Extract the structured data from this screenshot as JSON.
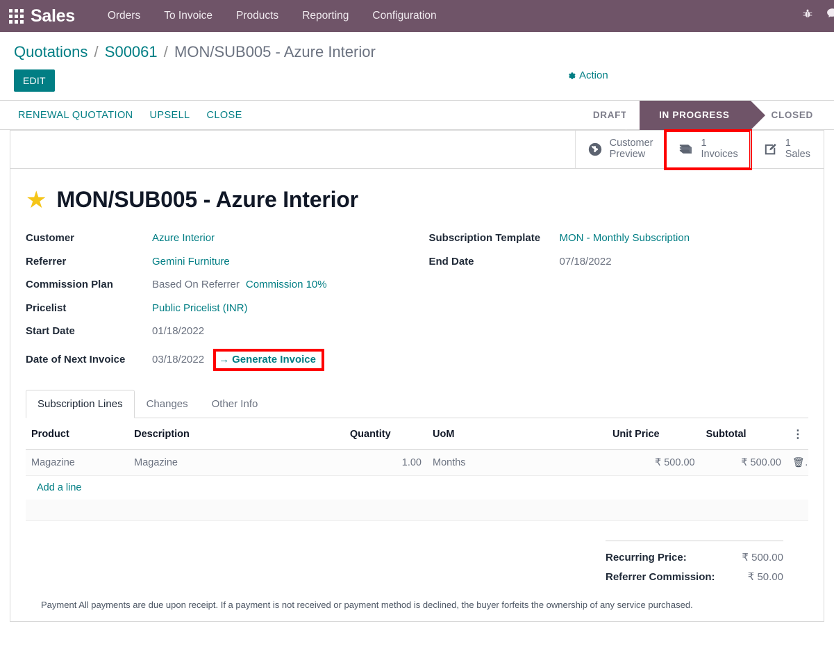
{
  "navbar": {
    "apps_icon": "apps-grid-icon",
    "brand": "Sales",
    "menus": [
      {
        "label": "Orders"
      },
      {
        "label": "To Invoice"
      },
      {
        "label": "Products"
      },
      {
        "label": "Reporting"
      },
      {
        "label": "Configuration"
      }
    ],
    "sys_icons": [
      {
        "name": "bug-icon",
        "glyph": "☲"
      },
      {
        "name": "messages-icon",
        "glyph": "●"
      }
    ],
    "background": "#6f5468"
  },
  "breadcrumb": {
    "root": "Quotations",
    "sep": "/",
    "parent": "S00061",
    "current": "MON/SUB005 - Azure Interior"
  },
  "control_panel": {
    "edit_label": "EDIT",
    "action_label": "Action",
    "action_icon": "gear-icon"
  },
  "statusbar": {
    "buttons": [
      {
        "label": "RENEWAL QUOTATION"
      },
      {
        "label": "UPSELL"
      },
      {
        "label": "CLOSE"
      }
    ],
    "stages": [
      {
        "label": "DRAFT",
        "active": false
      },
      {
        "label": "IN PROGRESS",
        "active": true
      },
      {
        "label": "CLOSED",
        "active": false
      }
    ],
    "active_color": "#6f5468"
  },
  "stat_buttons": [
    {
      "icon": "globe-icon",
      "value": "Customer",
      "label": "Preview",
      "highlighted": false
    },
    {
      "icon": "book-icon",
      "value": "1",
      "label": "Invoices",
      "highlighted": true
    },
    {
      "icon": "edit-square-icon",
      "value": "1",
      "label": "Sales",
      "highlighted": false
    }
  ],
  "record": {
    "star_icon": "star-filled-icon",
    "title": "MON/SUB005 - Azure Interior"
  },
  "form": {
    "left": [
      {
        "label": "Customer",
        "value": "Azure Interior",
        "link": true
      },
      {
        "label": "Referrer",
        "value": "Gemini Furniture",
        "link": true
      },
      {
        "label": "Commission Plan",
        "value": "Based On Referrer",
        "extra": "Commission 10%",
        "link": false
      },
      {
        "label": "Pricelist",
        "value": "Public Pricelist (INR)",
        "link": true
      },
      {
        "label": "Start Date",
        "value": "01/18/2022",
        "link": false
      },
      {
        "label": "Date of Next Invoice",
        "value": "03/18/2022",
        "link": false,
        "action": "Generate Invoice",
        "action_icon": "arrow-right-icon",
        "highlighted": true
      }
    ],
    "right": [
      {
        "label": "Subscription Template",
        "value": "MON - Monthly Subscription",
        "link": true
      },
      {
        "label": "End Date",
        "value": "07/18/2022",
        "link": false
      }
    ]
  },
  "notebook": {
    "tabs": [
      {
        "label": "Subscription Lines",
        "active": true
      },
      {
        "label": "Changes",
        "active": false
      },
      {
        "label": "Other Info",
        "active": false
      }
    ]
  },
  "lines_table": {
    "columns": [
      "Product",
      "Description",
      "Quantity",
      "UoM",
      "Unit Price",
      "Subtotal"
    ],
    "optional_columns_icon": "vertical-dots-icon",
    "rows": [
      {
        "product": "Magazine",
        "description": "Magazine",
        "quantity": "1.00",
        "uom": "Months",
        "unit_price": "₹ 500.00",
        "subtotal": "₹ 500.00",
        "delete_icon": "trash-icon"
      }
    ],
    "add_line_label": "Add a line"
  },
  "totals": [
    {
      "label": "Recurring Price:",
      "value": "₹ 500.00"
    },
    {
      "label": "Referrer Commission:",
      "value": "₹ 50.00"
    }
  ],
  "terms": {
    "text": "Payment All payments are due upon receipt. If a payment is not received or payment method is declined, the buyer forfeits the ownership of any service purchased."
  },
  "colors": {
    "brand_purple": "#6f5468",
    "teal_link": "#017e84",
    "annotation_red": "#fe0000",
    "star_gold": "#f5c518"
  }
}
